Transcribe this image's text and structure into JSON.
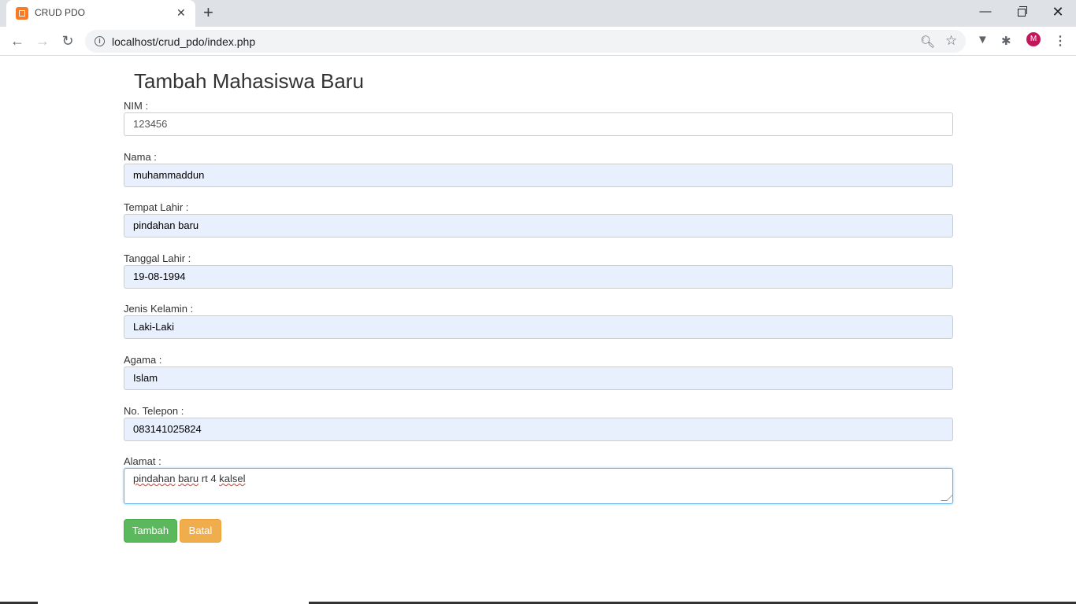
{
  "browser": {
    "tab_title": "CRUD PDO",
    "url": "localhost/crud_pdo/index.php",
    "avatar_letter": "M",
    "icons": [
      "back-icon",
      "forward-icon",
      "reload-icon",
      "info-icon",
      "zoom-icon",
      "star-icon",
      "extension-icon",
      "puzzle-icon",
      "menu-icon"
    ]
  },
  "form": {
    "title": "Tambah Mahasiswa Baru",
    "fields": [
      {
        "label": "NIM :",
        "value": "123456"
      },
      {
        "label": "Nama :",
        "value": "muhammaddun"
      },
      {
        "label": "Tempat Lahir :",
        "value": "pindahan baru"
      },
      {
        "label": "Tanggal Lahir :",
        "value": "19-08-1994"
      },
      {
        "label": "Jenis Kelamin :",
        "value": "Laki-Laki"
      },
      {
        "label": "Agama :",
        "value": "Islam"
      },
      {
        "label": "No. Telepon :",
        "value": "083141025824"
      }
    ],
    "alamat": {
      "label": "Alamat :",
      "words": [
        "pindahan",
        "baru",
        "rt",
        "4",
        "kalsel"
      ]
    },
    "buttons": {
      "submit": "Tambah",
      "cancel": "Batal"
    },
    "colors": {
      "success": "#5cb85c",
      "warning": "#f0ad4e",
      "autofill_bg": "#e8f0fe"
    }
  }
}
